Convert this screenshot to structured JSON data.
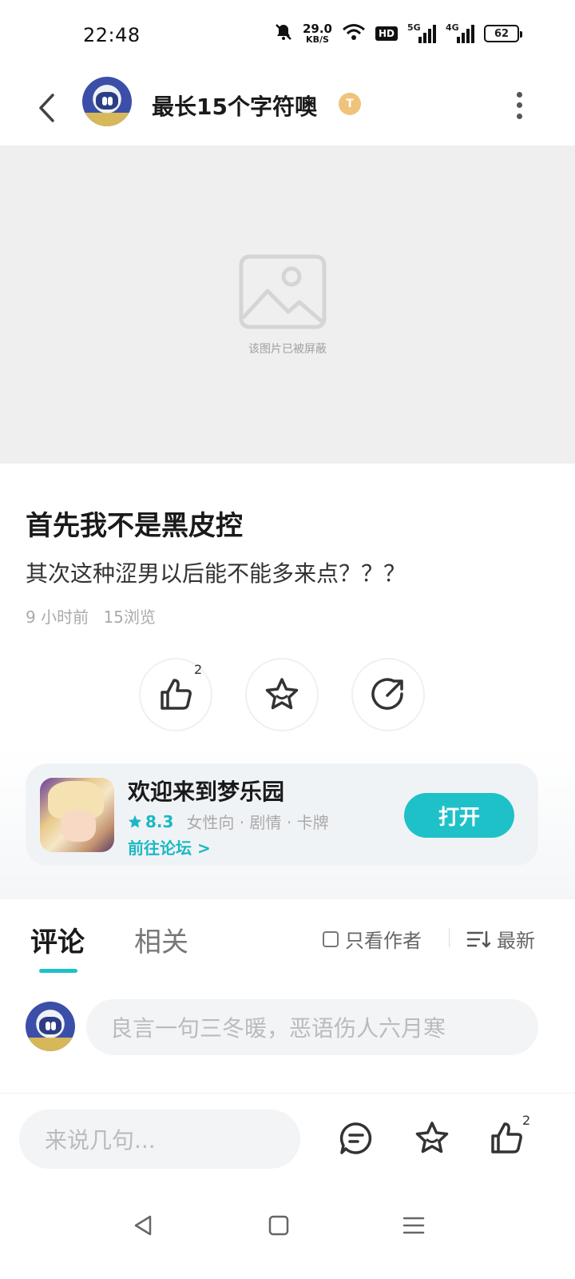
{
  "status_bar": {
    "time": "22:48",
    "net_speed_value": "29.0",
    "net_speed_unit": "KB/S",
    "hd_label": "HD",
    "signal_1_label": "5G",
    "signal_2_label": "4G",
    "battery_level": "62"
  },
  "header": {
    "title": "最长15个字符噢",
    "badge_text": "T"
  },
  "image": {
    "blocked_text": "该图片已被屏蔽"
  },
  "post": {
    "title": "首先我不是黑皮控",
    "body": "其次这种涩男以后能不能多来点？？？",
    "time_ago": "9 小时前",
    "views": "15浏览",
    "like_count": "2"
  },
  "game_card": {
    "name": "欢迎来到梦乐园",
    "rating": "8.3",
    "tags": "女性向 · 剧情 · 卡牌",
    "forum_link": "前往论坛 >",
    "open_label": "打开"
  },
  "tabs": {
    "comments": "评论",
    "related": "相关",
    "author_only": "只看作者",
    "sort_latest": "最新"
  },
  "comment_input": {
    "placeholder": "良言一句三冬暖，恶语伤人六月寒"
  },
  "bottom_bar": {
    "say_placeholder": "来说几句...",
    "like_count": "2"
  },
  "colors": {
    "accent": "#1fc1c8",
    "accent_text": "#1bb8c4"
  }
}
